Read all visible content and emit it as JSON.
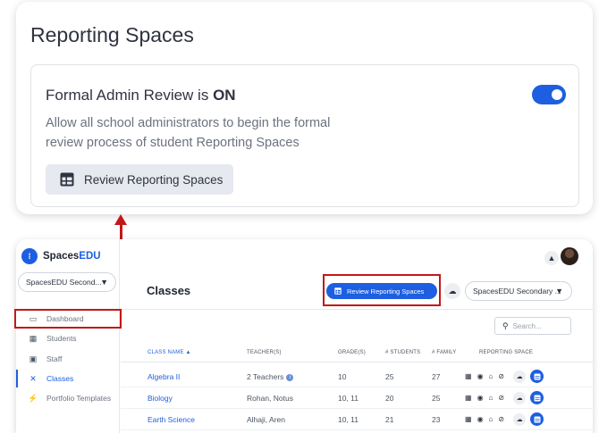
{
  "callout": {
    "title": "Reporting Spaces",
    "formal_review_prefix": "Formal Admin Review is ",
    "formal_review_state": "ON",
    "description": "Allow all school administrators to begin the formal review process of student Reporting Spaces",
    "review_button_label": "Review Reporting Spaces",
    "toggle_on": true
  },
  "app": {
    "logo_prefix": "Spaces",
    "logo_suffix": "EDU",
    "school_select_value": "SpacesEDU Second...",
    "nav": [
      {
        "label": "Dashboard",
        "icon": "laptop-icon"
      },
      {
        "label": "Students",
        "icon": "students-icon"
      },
      {
        "label": "Staff",
        "icon": "staff-icon"
      },
      {
        "label": "Classes",
        "icon": "classes-icon",
        "active": true
      },
      {
        "label": "Portfolio Templates",
        "icon": "templates-icon"
      }
    ],
    "page_title": "Classes",
    "review_button_label": "Review Reporting Spaces",
    "school_select_value_main": "SpacesEDU Secondary ...",
    "search_placeholder": "Search...",
    "columns": [
      "CLASS NAME",
      "TEACHER(S)",
      "GRADE(S)",
      "# STUDENTS",
      "# FAMILY",
      "REPORTING SPACE"
    ],
    "rows": [
      {
        "class": "Algebra II",
        "teachers": "2 Teachers",
        "grades": "10",
        "students": "25",
        "family": "27",
        "info": true
      },
      {
        "class": "Biology",
        "teachers": "Rohan, Notus",
        "grades": "10, 11",
        "students": "20",
        "family": "25"
      },
      {
        "class": "Earth Science",
        "teachers": "Alhaji, Aren",
        "grades": "10, 11",
        "students": "21",
        "family": "23"
      }
    ],
    "colors": {
      "accent": "#1d5fe0",
      "annotation": "#c21818"
    }
  }
}
